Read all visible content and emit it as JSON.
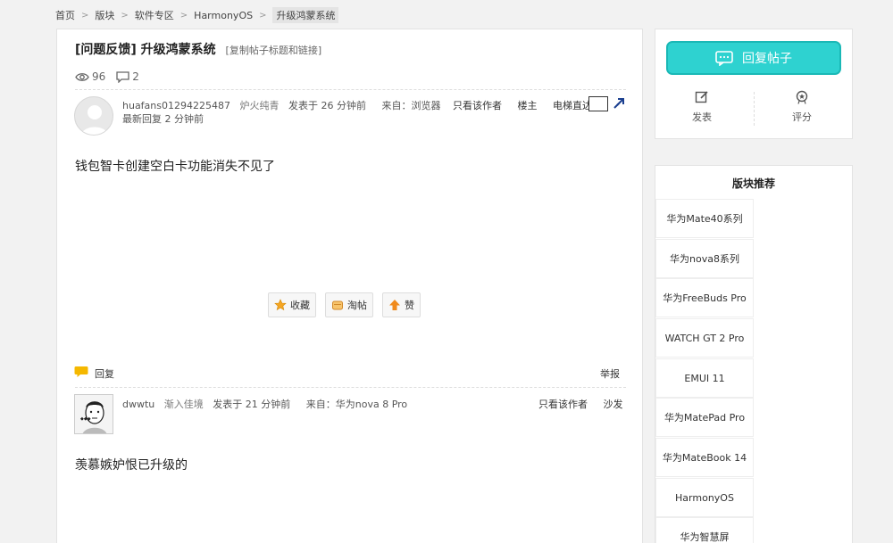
{
  "breadcrumb": [
    "首页",
    "版块",
    "软件专区",
    "HarmonyOS",
    "升级鸿蒙系统"
  ],
  "thread": {
    "category": "[问题反馈]",
    "title": "升级鸿蒙系统",
    "copy_link": "[复制帖子标题和链接]",
    "views": "96",
    "replies": "2"
  },
  "first_post": {
    "author": "huafans01294225487",
    "rank": "炉火纯青",
    "posted": "发表于 26 分钟前",
    "source_label": "来自：",
    "source": "浏览器",
    "latest_reply": "最新回复 2 分钟前",
    "only_author": "只看该作者",
    "floor": "楼主",
    "elevator": "电梯直达",
    "content": "钱包智卡创建空白卡功能消失不见了",
    "actions": [
      "收藏",
      "淘帖",
      "赞"
    ]
  },
  "reply_bar": {
    "reply": "回复",
    "report": "举报"
  },
  "second_post": {
    "author": "dwwtu",
    "rank": "渐入佳境",
    "posted": "发表于 21 分钟前",
    "source_label": "来自：",
    "source": "华为nova 8 Pro",
    "only_author": "只看该作者",
    "floor": "沙发",
    "content": "羡慕嫉妒恨已升级的"
  },
  "sidebar": {
    "reply_button": "回复帖子",
    "post_label": "发表",
    "rate_label": "评分",
    "recommend_title": "版块推荐",
    "recommend": [
      "华为Mate40系列",
      "华为nova8系列",
      "华为FreeBuds Pro",
      "WATCH GT 2 Pro",
      "EMUI 11",
      "华为MatePad Pro",
      "华为MateBook 14",
      "HarmonyOS",
      "华为智慧屏"
    ]
  },
  "colors": {
    "accent": "#2ed2d0",
    "accent_border": "#1ab8b6",
    "reply_icon": "#f5b800"
  }
}
